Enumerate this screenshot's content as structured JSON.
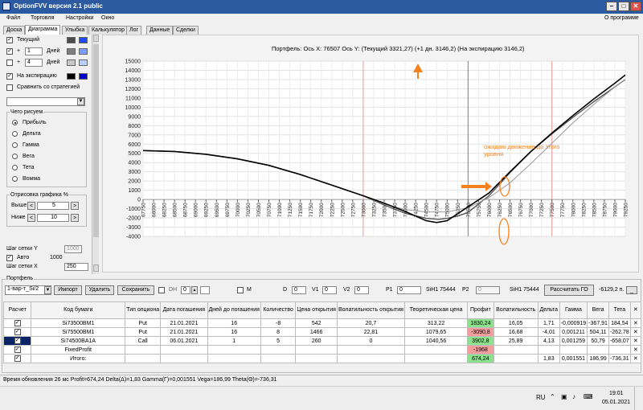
{
  "window": {
    "title": "OptionFVV версия 2.1 public"
  },
  "menu": {
    "file": "Файл",
    "trade": "Торговля",
    "settings": "Настройки",
    "window": "Окно",
    "about": "О программе"
  },
  "tabs": [
    "Доска",
    "Диаграмма",
    "Улыбка",
    "Калькулятор",
    "Лог",
    "Данные",
    "Сделки"
  ],
  "left": {
    "current": "Текущий",
    "plus": "+",
    "days": "Дней",
    "days1": "1",
    "days2": "4",
    "expiry": "На экспирацию",
    "compare": "Сравнить со стратегией",
    "what_title": "Чего рисуем",
    "radios": [
      "Прибыль",
      "Дельта",
      "Гамма",
      "Вега",
      "Тета",
      "Вомма"
    ],
    "render_title": "Отрисовка графика %",
    "above": "Выше",
    "below": "Ниже",
    "above_val": "5",
    "below_val": "10",
    "grid_y": "Шаг сетки Y",
    "grid_y_val": "1000",
    "auto": "Авто",
    "auto_val": "1000",
    "grid_x": "Шаг сетки X",
    "grid_x_val": "250",
    "colors": {
      "current": [
        "#4d4d4d",
        "#1f49ff"
      ],
      "plus1": [
        "#7e7e7e",
        "#7c9cff"
      ],
      "plus4": [
        "#c8c8c8",
        "#b8cfff"
      ],
      "expiry": [
        "#000000",
        "#0000cc"
      ]
    }
  },
  "chart_data": {
    "type": "line",
    "title": "Портфель: Ось X: 76507 Ось Y:  (Текущий 3321,27)  (+1 дн. 3146,2)  (На экспирацию 3146,2)",
    "xlim": [
      67750,
      79250
    ],
    "ylim": [
      -4000,
      15000
    ],
    "x_ticks": [
      67750,
      68000,
      68250,
      68500,
      68750,
      69000,
      69250,
      69500,
      69750,
      70000,
      70250,
      70500,
      70750,
      71000,
      71250,
      71500,
      71750,
      72000,
      72250,
      72500,
      72750,
      73000,
      73250,
      73500,
      73750,
      74000,
      74250,
      74500,
      74750,
      75000,
      75250,
      75500,
      75750,
      76000,
      76250,
      76500,
      76750,
      77000,
      77250,
      77500,
      77750,
      78000,
      78250,
      78500,
      78750,
      79000,
      79250
    ],
    "y_ticks": [
      -4000,
      -3000,
      -2000,
      -1000,
      0,
      1000,
      2000,
      3000,
      4000,
      5000,
      6000,
      7000,
      8000,
      9000,
      10000,
      11000,
      12000,
      13000,
      14000,
      15000
    ],
    "series": [
      {
        "name": "Текущий",
        "color": "#555555",
        "x": [
          67750,
          68500,
          69250,
          70000,
          70750,
          71500,
          72250,
          73000,
          73500,
          74000,
          74500,
          74800,
          75000,
          75250,
          75500,
          76000,
          76500,
          77000,
          77500,
          78000,
          78500,
          79000,
          79250
        ],
        "y": [
          5300,
          5200,
          4900,
          4400,
          3700,
          2700,
          1550,
          400,
          -600,
          -1500,
          -2050,
          -2150,
          -2050,
          -1800,
          -1400,
          400,
          2900,
          5200,
          7100,
          8900,
          10600,
          12200,
          13000
        ]
      },
      {
        "name": "+1 дн.",
        "color": "#999999",
        "x": [
          67750,
          68500,
          69250,
          70000,
          70750,
          71500,
          72250,
          73000,
          73500,
          74000,
          74500,
          75000,
          75500,
          76000,
          76500,
          77000,
          77500,
          78000,
          78500,
          79000,
          79250
        ],
        "y": [
          5300,
          5200,
          4900,
          4400,
          3700,
          2700,
          1550,
          400,
          -500,
          -1100,
          -1350,
          -1350,
          -900,
          200,
          1800,
          3900,
          6100,
          8300,
          10300,
          12200,
          13000
        ]
      },
      {
        "name": "На экспирацию",
        "color": "#000000",
        "x": [
          67750,
          68500,
          69250,
          70000,
          70750,
          71500,
          72250,
          73000,
          73500,
          74000,
          74500,
          74750,
          75000,
          75500,
          76000,
          76500,
          77000,
          77500,
          78000,
          78500,
          79000,
          79250
        ],
        "y": [
          5300,
          5200,
          4900,
          4400,
          3700,
          2700,
          1550,
          400,
          -400,
          -1300,
          -2300,
          -2500,
          -2300,
          -800,
          700,
          3000,
          5200,
          7200,
          9100,
          10900,
          12600,
          13500
        ]
      }
    ],
    "vlines": [
      {
        "x": 73000,
        "color": "#ef9a9a"
      },
      {
        "x": 75500,
        "color": "#808080"
      },
      {
        "x": 77500,
        "color": "#ef9a9a"
      }
    ],
    "annotations": [
      {
        "text": "ожидаю движение до этого уровня",
        "color": "#f58220"
      }
    ]
  },
  "portfolio": {
    "title": "Портфель",
    "strategy": "1-вар-т_Si/2",
    "import": "Импорт",
    "delete": "Удалить",
    "save": "Сохранить",
    "dh": "DH",
    "dh_val": "0",
    "m": "M",
    "d_lbl": "D",
    "d_val": "0",
    "v1_lbl": "V1",
    "v1_val": "0",
    "v2_lbl": "V2",
    "v2_val": "0",
    "p1_lbl": "P1",
    "p1_val": "0",
    "si1_lbl": "SiH1 75444",
    "p2_lbl": "P2",
    "p2_val": "0",
    "si2_lbl": "SiH1 75444",
    "calc": "Рассчитать ГО",
    "go_val": "-6129,2 п.",
    "columns": [
      "Расчет",
      "Код бумаги",
      "Тип опциона",
      "Дата погашения",
      "Дней до погашения",
      "Количество",
      "Цена открытия",
      "Волатильность открытия",
      "Теоретическая цена",
      "Профит",
      "Волатильность",
      "Дельта",
      "Гамма",
      "Вега",
      "Тета",
      "✕"
    ],
    "rows": [
      {
        "code": "Si73500BM1",
        "type": "Put",
        "date": "21.01.2021",
        "days": "16",
        "qty": "-8",
        "price": "542",
        "vol_open": "20,7",
        "theo": "313,22",
        "profit": "1830,24",
        "profit_sign": "pos",
        "vol": "16,05",
        "delta": "1,71",
        "gamma": "-0,000919",
        "vega": "-367,91",
        "theta": "184,54"
      },
      {
        "code": "Si75500BM1",
        "type": "Put",
        "date": "21.01.2021",
        "days": "16",
        "qty": "8",
        "price": "1466",
        "vol_open": "22,81",
        "theo": "1079,65",
        "profit": "-3090,8",
        "profit_sign": "neg",
        "vol": "16,68",
        "delta": "-4,01",
        "gamma": "0,001211",
        "vega": "504,11",
        "theta": "-262,78"
      },
      {
        "code": "Si74500BA1A",
        "type": "Call",
        "date": "06.01.2021",
        "days": "1",
        "qty": "5",
        "price": "260",
        "vol_open": "0",
        "theo": "1040,56",
        "profit": "3902,8",
        "profit_sign": "pos",
        "vol": "25,89",
        "delta": "4,13",
        "gamma": "0,001259",
        "vega": "50,79",
        "theta": "-658,07"
      },
      {
        "code": "FixedProfit",
        "type": "",
        "date": "",
        "days": "",
        "qty": "",
        "price": "",
        "vol_open": "",
        "theo": "",
        "profit": "-1968",
        "profit_sign": "neg",
        "vol": "",
        "delta": "",
        "gamma": "",
        "vega": "",
        "theta": ""
      },
      {
        "code": "Итого:",
        "type": "",
        "date": "",
        "days": "",
        "qty": "",
        "price": "",
        "vol_open": "",
        "theo": "",
        "profit": "674,24",
        "profit_sign": "pos",
        "vol": "",
        "delta": "1,83",
        "gamma": "0,001551",
        "vega": "186,99",
        "theta": "-736,31"
      }
    ]
  },
  "status": "Время обновления 26 мс  Profit=674,24 Delta(Δ)=1,83 Gamma(Γ)=0,001551 Vega=186,99 Theta(Θ)=-736,31",
  "taskbar": {
    "lang": "RU",
    "time": "19:01",
    "date": "05.01.2021"
  }
}
